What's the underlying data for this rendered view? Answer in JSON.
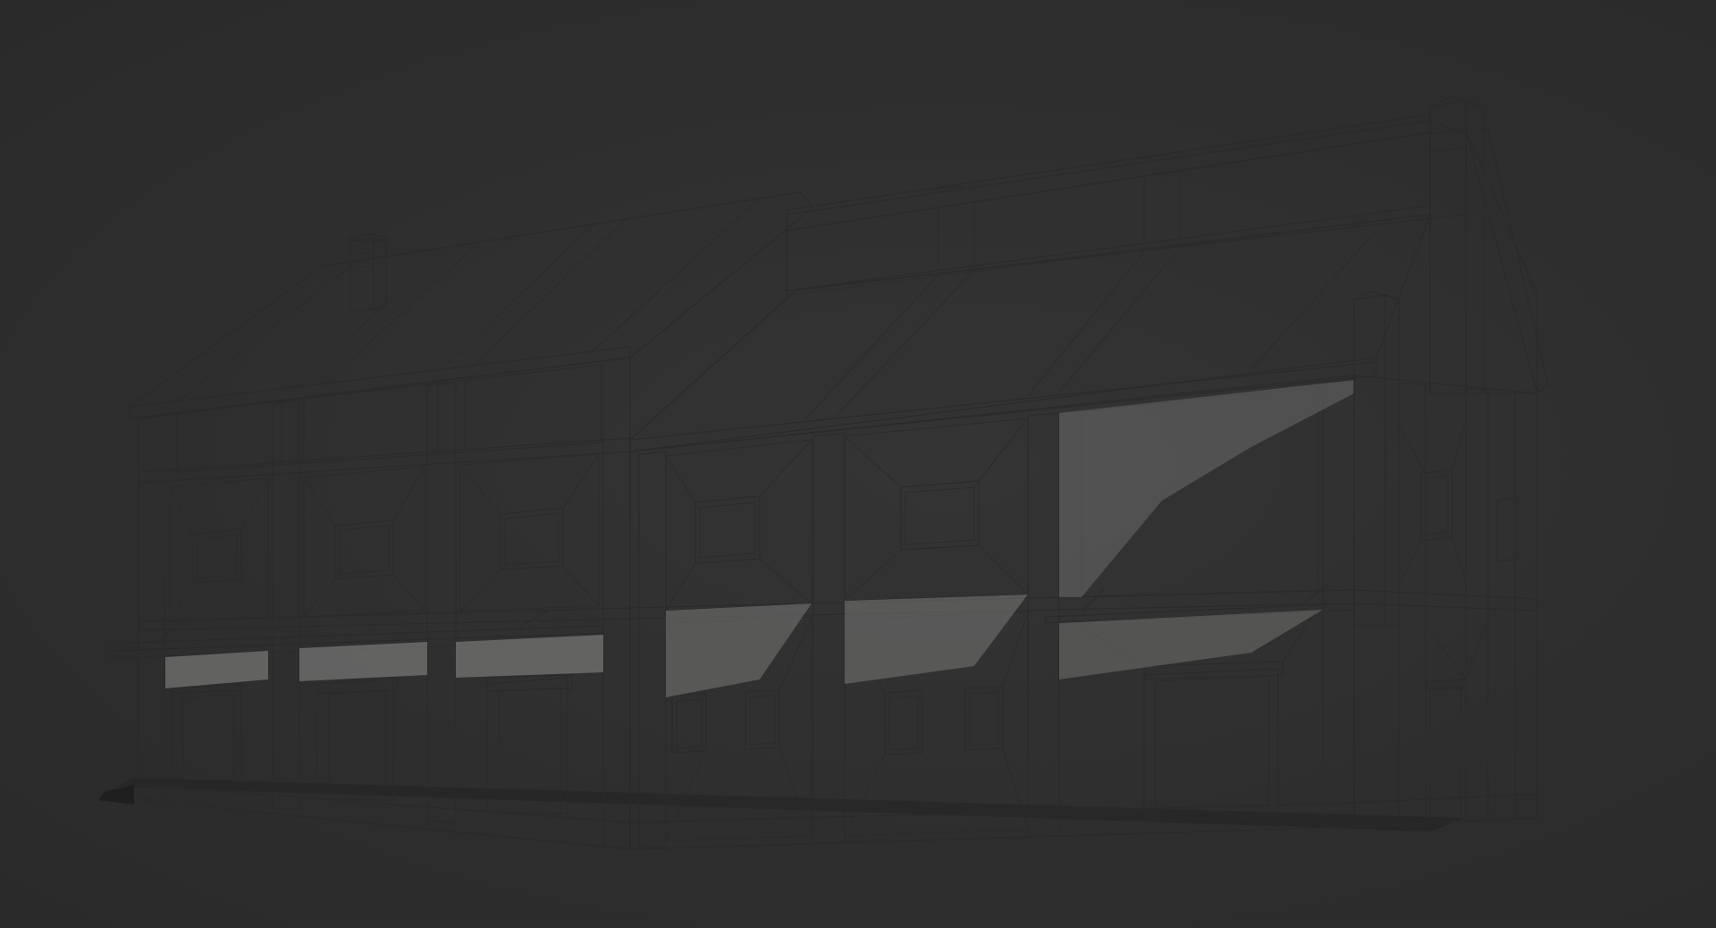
{
  "scene": {
    "subject": "building-model",
    "colors": {
      "background": "#2f2f2f",
      "wall_light": "#b9b9b9",
      "wall_shadow": "#8e8e8e",
      "roof_light": "#c4c4c2",
      "roof_mid": "#a9a9a7",
      "wire": "#2a2a2a"
    }
  }
}
